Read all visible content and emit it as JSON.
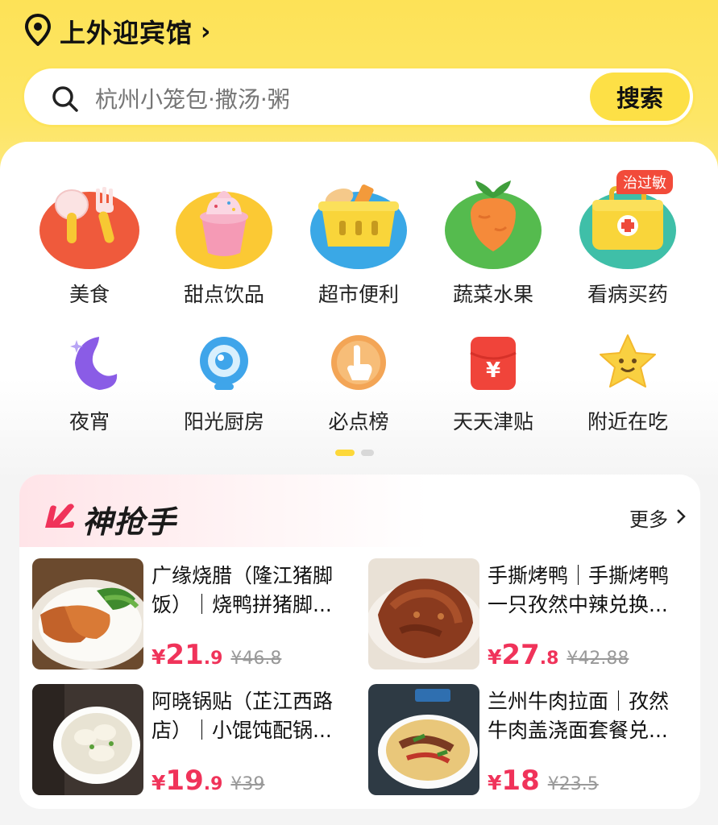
{
  "location": {
    "name": "上外迎宾馆",
    "arrow": "›"
  },
  "search": {
    "placeholder": "杭州小笼包·撒汤·粥",
    "button_label": "搜索"
  },
  "categories_row1": [
    {
      "label": "美食",
      "icon": "utensils-icon"
    },
    {
      "label": "甜点饮品",
      "icon": "ice-cream-icon"
    },
    {
      "label": "超市便利",
      "icon": "basket-icon"
    },
    {
      "label": "蔬菜水果",
      "icon": "carrot-icon"
    },
    {
      "label": "看病买药",
      "icon": "medicine-kit-icon",
      "badge": "治过敏"
    }
  ],
  "categories_row2": [
    {
      "label": "夜宵",
      "icon": "moon-icon"
    },
    {
      "label": "阳光厨房",
      "icon": "camera-icon"
    },
    {
      "label": "必点榜",
      "icon": "pointer-hand-icon"
    },
    {
      "label": "天天津贴",
      "icon": "red-packet-icon"
    },
    {
      "label": "附近在吃",
      "icon": "star-face-icon"
    }
  ],
  "pager": {
    "active_index": 0,
    "total": 2
  },
  "flash_sale": {
    "title": "神抢手",
    "more_label": "更多",
    "deals": [
      {
        "title": "广缘烧腊（隆江猪脚饭）｜烧鸭拼猪脚...",
        "currency": "¥",
        "price_int": "21",
        "price_dec": ".9",
        "original": "¥46.8"
      },
      {
        "title": "手撕烤鸭｜手撕烤鸭一只孜然中辣兑换...",
        "currency": "¥",
        "price_int": "27",
        "price_dec": ".8",
        "original": "¥42.88"
      },
      {
        "title": "阿晓锅贴（芷江西路店）｜小馄饨配锅...",
        "currency": "¥",
        "price_int": "19",
        "price_dec": ".9",
        "original": "¥39"
      },
      {
        "title": "兰州牛肉拉面｜孜然牛肉盖浇面套餐兑...",
        "currency": "¥",
        "price_int": "18",
        "price_dec": "",
        "original": "¥23.5"
      }
    ]
  },
  "colors": {
    "brand_yellow": "#fde046",
    "price_red": "#f0335a",
    "badge_red": "#f24b3a"
  }
}
